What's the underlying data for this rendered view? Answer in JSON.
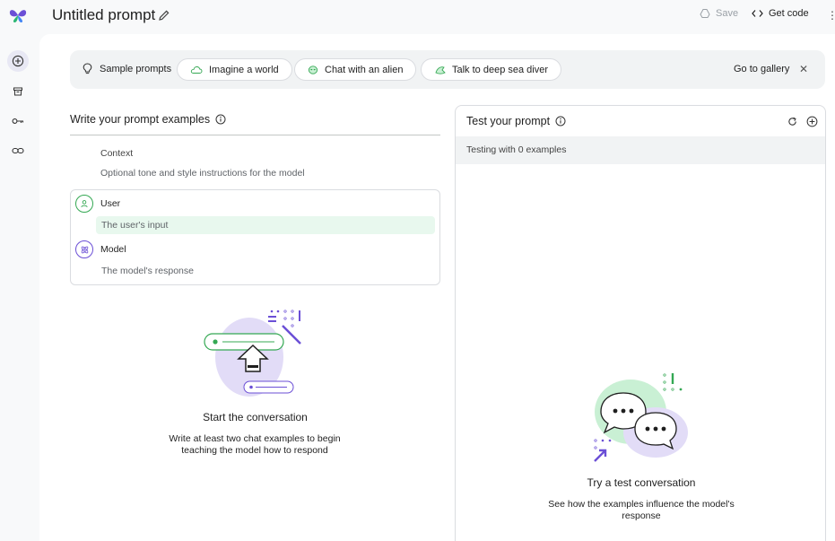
{
  "header": {
    "title": "Untitled prompt",
    "save_label": "Save",
    "get_code_label": "Get code"
  },
  "rail": {
    "items": [
      "add-icon",
      "archive-icon",
      "key-icon",
      "link-icon"
    ]
  },
  "sample_prompts": {
    "label": "Sample prompts",
    "chips": [
      {
        "label": "Imagine a world",
        "icon": "cloud-icon"
      },
      {
        "label": "Chat with an alien",
        "icon": "alien-icon"
      },
      {
        "label": "Talk to deep sea diver",
        "icon": "fish-icon"
      }
    ],
    "gallery_label": "Go to gallery"
  },
  "examples": {
    "heading": "Write your prompt examples",
    "context_label": "Context",
    "context_placeholder": "Optional tone and style instructions for the model",
    "user_label": "User",
    "user_placeholder": "The user's input",
    "model_label": "Model",
    "model_placeholder": "The model's response",
    "empty_title": "Start the conversation",
    "empty_subtitle": "Write at least two chat examples to begin teaching the model how to respond"
  },
  "test": {
    "heading": "Test your prompt",
    "status": "Testing with 0 examples",
    "empty_title": "Try a test conversation",
    "empty_subtitle": "See how the examples influence the model's response"
  },
  "colors": {
    "accent_purple": "#6b4fd6",
    "accent_green": "#34a853",
    "highlight_green": "#e8f8ee",
    "illustration_purple": "#e2dcf7",
    "illustration_green": "#c9f0d4"
  }
}
